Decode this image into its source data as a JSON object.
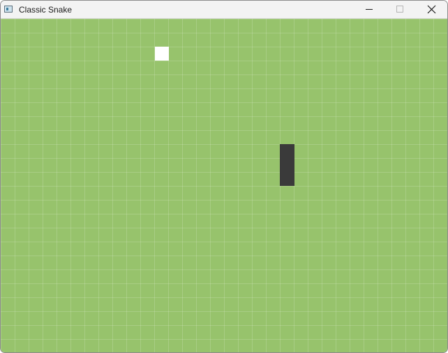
{
  "window": {
    "title": "Classic Snake",
    "app_icon": "window-app-icon",
    "controls": {
      "minimize_icon": "minimize-icon",
      "maximize_icon": "maximize-icon",
      "close_icon": "close-icon"
    }
  },
  "game": {
    "board_color": "#97c36c",
    "grid_line_color": "#ffffff",
    "food_color": "#ffffff",
    "snake_color": "#3a3a3a"
  }
}
